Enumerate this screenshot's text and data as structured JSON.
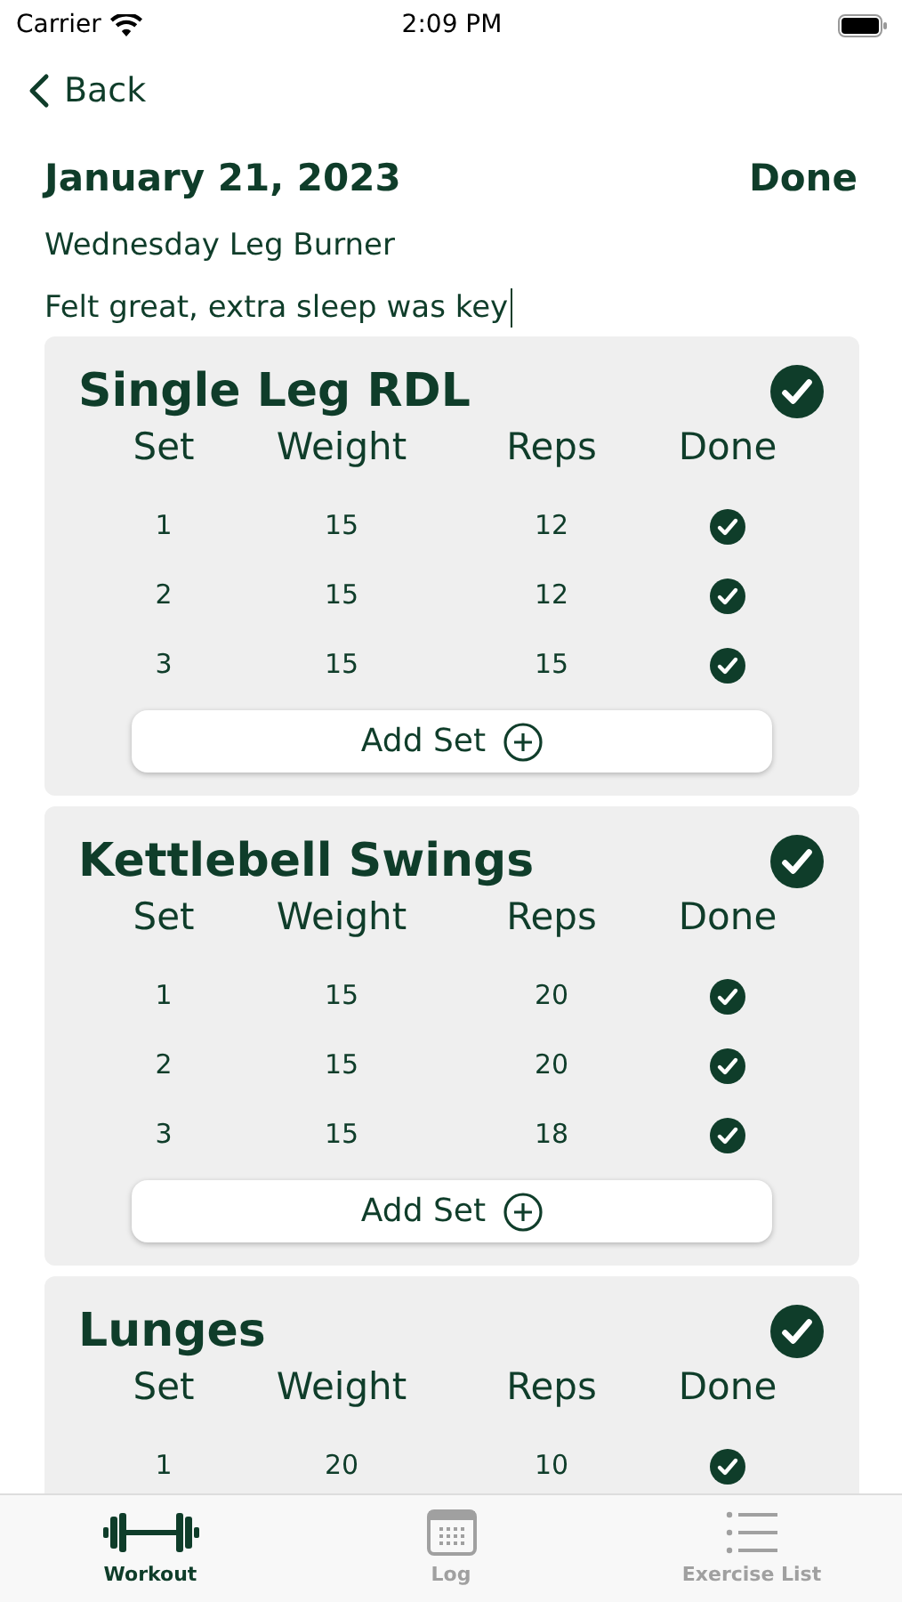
{
  "status_bar": {
    "carrier": "Carrier",
    "time": "2:09 PM"
  },
  "nav": {
    "back": "Back"
  },
  "header": {
    "date": "January 21, 2023",
    "done": "Done"
  },
  "workout": {
    "name": "Wednesday Leg Burner",
    "notes": "Felt great, extra sleep was key"
  },
  "exercises": [
    {
      "name": "Single Leg RDL",
      "done": true,
      "columns": [
        "Set",
        "Weight",
        "Reps",
        "Done"
      ],
      "add_label": "Add Set",
      "sets": [
        {
          "set": "1",
          "weight": "15",
          "reps": "12",
          "done": true
        },
        {
          "set": "2",
          "weight": "15",
          "reps": "12",
          "done": true
        },
        {
          "set": "3",
          "weight": "15",
          "reps": "15",
          "done": true
        }
      ]
    },
    {
      "name": "Kettlebell Swings",
      "done": true,
      "columns": [
        "Set",
        "Weight",
        "Reps",
        "Done"
      ],
      "add_label": "Add Set",
      "sets": [
        {
          "set": "1",
          "weight": "15",
          "reps": "20",
          "done": true
        },
        {
          "set": "2",
          "weight": "15",
          "reps": "20",
          "done": true
        },
        {
          "set": "3",
          "weight": "15",
          "reps": "18",
          "done": true
        }
      ]
    },
    {
      "name": "Lunges",
      "done": true,
      "columns": [
        "Set",
        "Weight",
        "Reps",
        "Done"
      ],
      "sets": [
        {
          "set": "1",
          "weight": "20",
          "reps": "10",
          "done": true
        }
      ]
    }
  ],
  "tabs": [
    {
      "label": "Workout",
      "kind": "dumbbell",
      "selected": true
    },
    {
      "label": "Log",
      "kind": "calendar",
      "selected": false
    },
    {
      "label": "Exercise List",
      "kind": "list",
      "selected": false
    }
  ]
}
